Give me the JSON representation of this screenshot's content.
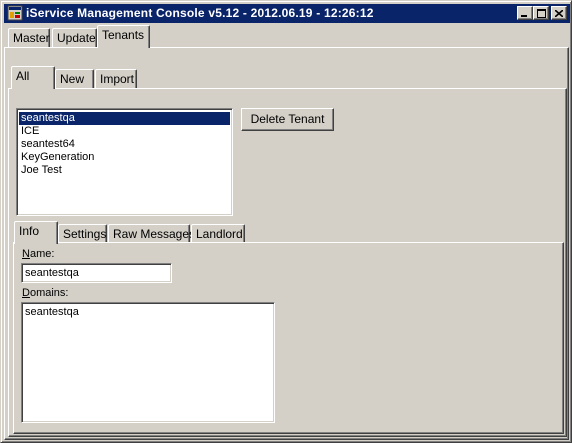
{
  "window": {
    "title": "iService Management Console v5.12 - 2012.06.19 - 12:26:12",
    "controls": {
      "minimize": "minimize-icon",
      "maximize": "maximize-icon",
      "close": "close-icon"
    }
  },
  "main_tabs": [
    {
      "label": "Master",
      "selected": false
    },
    {
      "label": "Update",
      "selected": false
    },
    {
      "label": "Tenants",
      "selected": true
    }
  ],
  "tenant_tabs": [
    {
      "label": "All",
      "selected": true
    },
    {
      "label": "New",
      "selected": false
    },
    {
      "label": "Import",
      "selected": false
    }
  ],
  "tenant_list": {
    "items": [
      "seantestqa",
      "ICE",
      "seantest64",
      "KeyGeneration",
      "Joe Test"
    ],
    "selected_index": 0
  },
  "delete_button": {
    "label": "Delete Tenant"
  },
  "detail_tabs": [
    {
      "label": "Info",
      "selected": true
    },
    {
      "label": "Settings",
      "selected": false
    },
    {
      "label": "Raw Messages",
      "selected": false
    },
    {
      "label": "Landlord",
      "selected": false
    }
  ],
  "info": {
    "name_label_first": "N",
    "name_label_rest": "ame:",
    "name_value": "seantestqa",
    "domains_label_first": "D",
    "domains_label_rest": "omains:",
    "domains_value": "seantestqa"
  },
  "colors": {
    "title_bar": "#0a246a",
    "face": "#d4d0c8",
    "selection": "#0a246a"
  }
}
